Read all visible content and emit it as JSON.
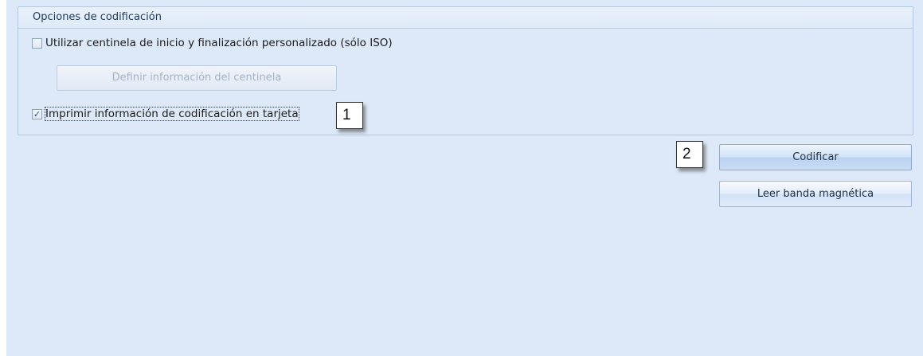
{
  "group": {
    "title": "Opciones de codificación"
  },
  "options": {
    "custom_sentinel": {
      "label": "Utilizar centinela de inicio y finalización personalizado (sólo ISO)",
      "checked": false
    },
    "define_sentinel_button": "Definir información del centinela",
    "print_encoding": {
      "label": "Imprimir información de codificación en tarjeta",
      "checked": true
    }
  },
  "actions": {
    "encode_button": "Codificar",
    "read_stripe_button": "Leer banda magnética"
  },
  "callouts": {
    "one": "1",
    "two": "2"
  },
  "icons": {
    "check": "check-icon"
  },
  "colors": {
    "panel_background": "#dde9f8",
    "group_border": "#b3c7e0"
  }
}
